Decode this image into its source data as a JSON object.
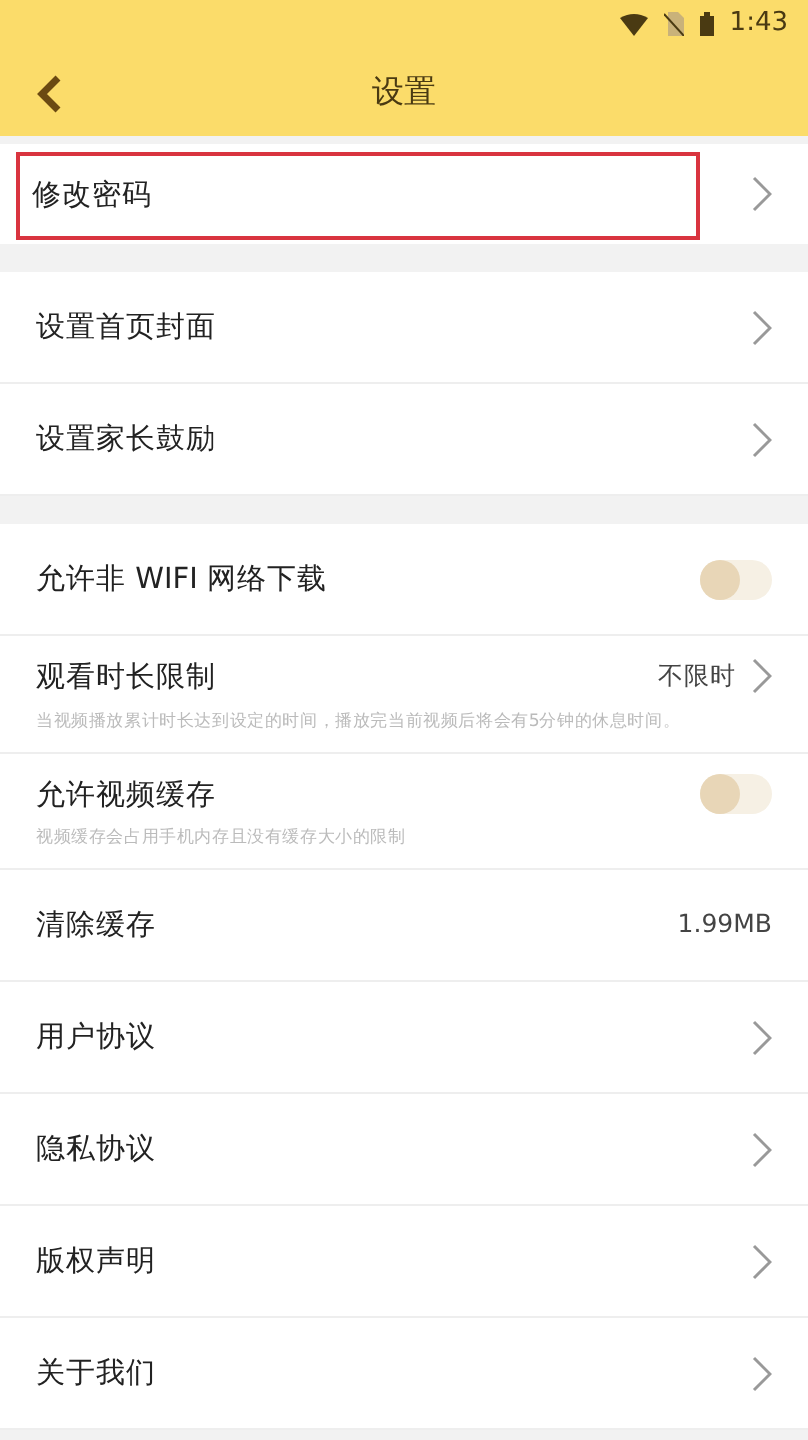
{
  "status_bar": {
    "time": "1:43"
  },
  "header": {
    "title": "设置"
  },
  "groups": [
    {
      "items": [
        {
          "kind": "nav",
          "label": "修改密码",
          "highlighted": true
        }
      ]
    },
    {
      "items": [
        {
          "kind": "nav",
          "label": "设置首页封面",
          "highlighted": false
        },
        {
          "kind": "nav",
          "label": "设置家长鼓励",
          "highlighted": false
        }
      ]
    },
    {
      "items": [
        {
          "kind": "toggle",
          "label": "允许非 WIFI 网络下载",
          "on": false
        },
        {
          "kind": "nav",
          "label": "观看时长限制",
          "value": "不限时",
          "subtitle": "当视频播放累计时长达到设定的时间，播放完当前视频后将会有5分钟的休息时间。",
          "highlighted": false
        },
        {
          "kind": "toggle",
          "label": "允许视频缓存",
          "subtitle": "视频缓存会占用手机内存且没有缓存大小的限制",
          "on": false
        },
        {
          "kind": "info",
          "label": "清除缓存",
          "value": "1.99MB"
        },
        {
          "kind": "nav",
          "label": "用户协议",
          "highlighted": false
        },
        {
          "kind": "nav",
          "label": "隐私协议",
          "highlighted": false
        },
        {
          "kind": "nav",
          "label": "版权声明",
          "highlighted": false
        },
        {
          "kind": "nav",
          "label": "关于我们",
          "highlighted": false
        }
      ]
    }
  ]
}
